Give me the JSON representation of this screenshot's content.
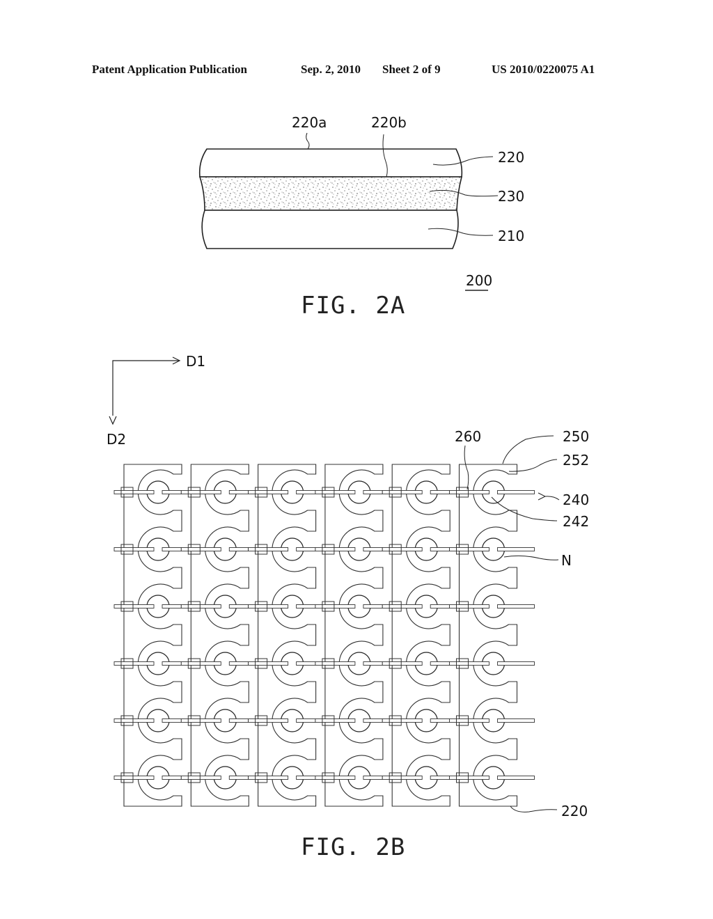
{
  "header": {
    "publication": "Patent Application Publication",
    "date": "Sep. 2, 2010",
    "sheet": "Sheet 2 of 9",
    "number": "US 2010/0220075 A1"
  },
  "fig2a": {
    "caption": "FIG. 2A",
    "assembly_ref": "200",
    "labels": {
      "top_surface": "220a",
      "bottom_surface": "220b",
      "top_layer": "220",
      "middle_layer": "230",
      "bottom_layer": "210"
    }
  },
  "fig2b": {
    "caption": "FIG. 2B",
    "axes": {
      "d1": "D1",
      "d2": "D2"
    },
    "grid": {
      "columns": 6,
      "rows": 6
    },
    "labels": {
      "tft": "260",
      "pixel_block": "250",
      "opening": "252",
      "line": "240",
      "electrode": "242",
      "gap": "N",
      "substrate": "220"
    }
  }
}
